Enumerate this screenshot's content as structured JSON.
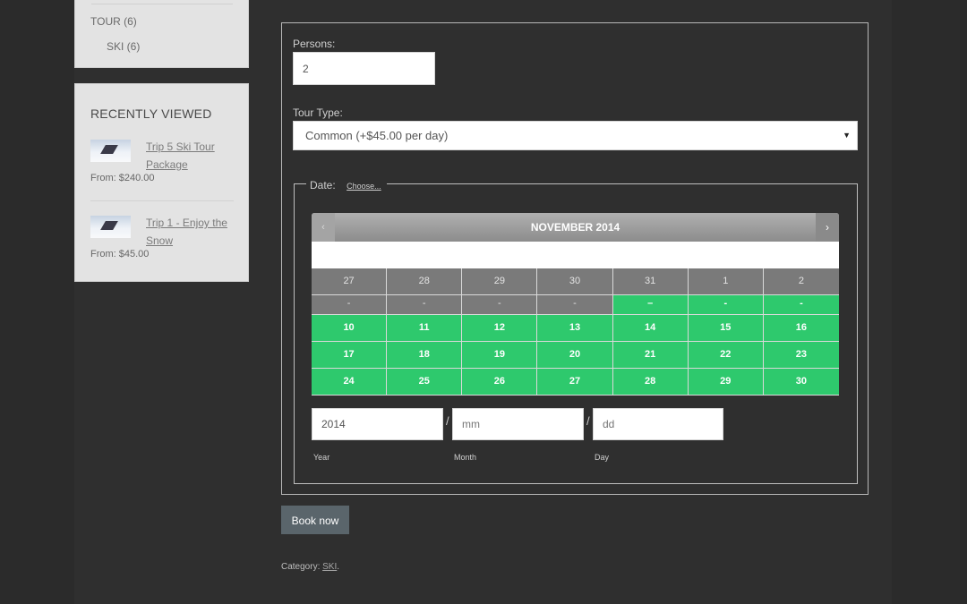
{
  "sidebar": {
    "categories": [
      {
        "label": "TOUR (6)"
      },
      {
        "label": "SKI (6)"
      }
    ],
    "recently_viewed": {
      "title": "RECENTLY VIEWED",
      "items": [
        {
          "title": "Trip 5 Ski Tour Package",
          "price": "From: $240.00",
          "icon": "skier-thumbnail"
        },
        {
          "title": "Trip 1 - Enjoy the Snow",
          "price": "From: $45.00",
          "icon": "skier-thumbnail"
        }
      ]
    }
  },
  "booking": {
    "persons_label": "Persons:",
    "persons_value": "2",
    "tour_type_label": "Tour Type:",
    "tour_type_value": "Common (+$45.00 per day)",
    "date_legend": "Date:",
    "choose_link": "Choose...",
    "calendar": {
      "month_title": "NOVEMBER 2014",
      "prev_icon": "‹",
      "next_icon": "›",
      "rows": [
        [
          {
            "d": "27",
            "s": "past"
          },
          {
            "d": "28",
            "s": "past"
          },
          {
            "d": "29",
            "s": "past"
          },
          {
            "d": "30",
            "s": "past"
          },
          {
            "d": "31",
            "s": "past"
          },
          {
            "d": "1",
            "s": "past"
          },
          {
            "d": "2",
            "s": "past"
          }
        ],
        [
          {
            "d": "-",
            "s": "past"
          },
          {
            "d": "-",
            "s": "past"
          },
          {
            "d": "-",
            "s": "past"
          },
          {
            "d": "-",
            "s": "past"
          },
          {
            "d": "–",
            "s": "avail"
          },
          {
            "d": "-",
            "s": "avail"
          },
          {
            "d": "-",
            "s": "avail"
          }
        ],
        [
          {
            "d": "10",
            "s": "avail"
          },
          {
            "d": "11",
            "s": "avail"
          },
          {
            "d": "12",
            "s": "avail"
          },
          {
            "d": "13",
            "s": "avail"
          },
          {
            "d": "14",
            "s": "avail"
          },
          {
            "d": "15",
            "s": "avail"
          },
          {
            "d": "16",
            "s": "avail"
          }
        ],
        [
          {
            "d": "17",
            "s": "avail"
          },
          {
            "d": "18",
            "s": "avail"
          },
          {
            "d": "19",
            "s": "avail"
          },
          {
            "d": "20",
            "s": "avail"
          },
          {
            "d": "21",
            "s": "avail"
          },
          {
            "d": "22",
            "s": "avail"
          },
          {
            "d": "23",
            "s": "avail"
          }
        ],
        [
          {
            "d": "24",
            "s": "avail"
          },
          {
            "d": "25",
            "s": "avail"
          },
          {
            "d": "26",
            "s": "avail"
          },
          {
            "d": "27",
            "s": "avail"
          },
          {
            "d": "28",
            "s": "avail"
          },
          {
            "d": "29",
            "s": "avail"
          },
          {
            "d": "30",
            "s": "avail"
          }
        ]
      ]
    },
    "year_value": "2014",
    "month_placeholder": "mm",
    "day_placeholder": "dd",
    "year_label": "Year",
    "month_label": "Month",
    "day_label": "Day",
    "separator": "/",
    "book_button": "Book now",
    "category_prefix": "Category:",
    "category_link": "SKI",
    "category_suffix": "."
  },
  "colors": {
    "background": "#2b2b2b",
    "widget": "#e3e3e3",
    "available": "#2ec96d",
    "past": "#7a7a7a",
    "button": "#5a656b"
  }
}
